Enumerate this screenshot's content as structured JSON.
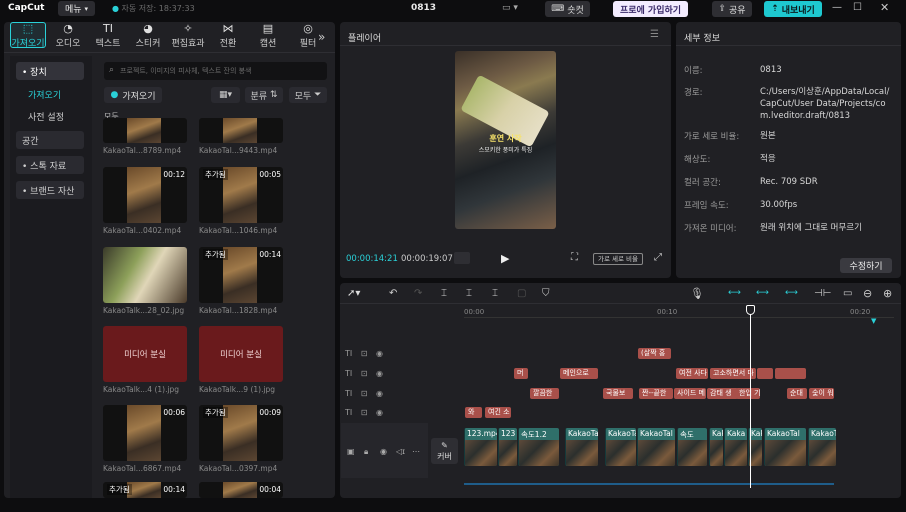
{
  "app": {
    "logo": "CapCut",
    "menu": "메뉴",
    "autosave": "자동 저장: 18:37:33",
    "project": "0813",
    "shortcut": "숏컷",
    "pro": "프로에 가입하기",
    "share": "공유",
    "export": "내보내기"
  },
  "tools": [
    {
      "label": "가져오기",
      "icon": "import-icon",
      "glyph": "⬚"
    },
    {
      "label": "오디오",
      "icon": "audio-icon",
      "glyph": "◔"
    },
    {
      "label": "텍스트",
      "icon": "text-icon",
      "glyph": "TI"
    },
    {
      "label": "스티커",
      "icon": "sticker-icon",
      "glyph": "◕"
    },
    {
      "label": "편집효과",
      "icon": "effects-icon",
      "glyph": "✧"
    },
    {
      "label": "전환",
      "icon": "transition-icon",
      "glyph": "⋈"
    },
    {
      "label": "캡션",
      "icon": "caption-icon",
      "glyph": "▤"
    },
    {
      "label": "필터",
      "icon": "filter-icon",
      "glyph": "◎"
    }
  ],
  "sidebar": {
    "device": "• 장치",
    "import": "가져오기",
    "presets": "사전 설정",
    "space": "공간",
    "stock": "• 스톡 자료",
    "brand": "• 브랜드 자산"
  },
  "media": {
    "search_placeholder": "프로젝트, 이미지의 피사체, 텍스트 잔의 봉색",
    "import_btn": "가져오기",
    "sort": "분류",
    "all_filter": "모두",
    "section": "모두",
    "items": [
      {
        "name": "KakaoTal...8789.mp4",
        "dur": "",
        "chip": ""
      },
      {
        "name": "KakaoTal...9443.mp4",
        "dur": "",
        "chip": ""
      },
      {
        "name": "KakaoTal...0402.mp4",
        "dur": "00:12",
        "chip": ""
      },
      {
        "name": "KakaoTal...1046.mp4",
        "dur": "00:05",
        "chip": "추가됨"
      },
      {
        "name": "KakaoTalk...28_02.jpg",
        "dur": "",
        "chip": ""
      },
      {
        "name": "KakaoTal...1828.mp4",
        "dur": "00:14",
        "chip": "추가됨"
      },
      {
        "name": "KakaoTalk...4 (1).jpg",
        "dur": "",
        "chip": "",
        "missing": "미디어 분실"
      },
      {
        "name": "KakaoTalk...9 (1).jpg",
        "dur": "",
        "chip": "",
        "missing": "미디어 분실"
      },
      {
        "name": "KakaoTal...6867.mp4",
        "dur": "00:06",
        "chip": ""
      },
      {
        "name": "KakaoTal...0397.mp4",
        "dur": "00:09",
        "chip": "추가됨"
      },
      {
        "name": "",
        "dur": "00:14",
        "chip": "추가됨"
      },
      {
        "name": "",
        "dur": "00:04",
        "chip": ""
      }
    ]
  },
  "player": {
    "title": "플레이어",
    "current": "00:00:14:21",
    "total": "00:00:19:07",
    "ratio": "가로 세로 비율",
    "caption_main": "훈연 사작",
    "caption_sub": "스모키한 풍미가 특징"
  },
  "details": {
    "title": "세부 정보",
    "rows": [
      {
        "label": "이름:",
        "value": "0813"
      },
      {
        "label": "경로:",
        "value": "C:/Users/이상훈/AppData/Local/CapCut/User Data/Projects/com.lveditor.draft/0813"
      },
      {
        "label": "가로 세로 비율:",
        "value": "원본"
      },
      {
        "label": "해상도:",
        "value": "적응"
      },
      {
        "label": "컬러 공간:",
        "value": "Rec. 709 SDR"
      },
      {
        "label": "프레임 속도:",
        "value": "30.00fps"
      },
      {
        "label": "가져온 미디어:",
        "value": "원래 위치에 그대로 머무르기"
      }
    ],
    "edit_btn": "수정하기"
  },
  "timeline": {
    "ruler": [
      "00:00",
      "00:10",
      "00:20"
    ],
    "cover": "커버",
    "text_clips": [
      [
        "(살짝 홍"
      ],
      [
        "머",
        "메인으로",
        "여전 사다",
        "고소하면서 다",
        "",
        ""
      ],
      [
        "깔끔한",
        "국물보",
        "짠--끝한",
        "사이드 메",
        "감태 생",
        "한입 기",
        "순대",
        "숯이 워"
      ],
      [
        "와",
        "여긴 소"
      ]
    ],
    "video_clips": [
      "123.mp4",
      "123",
      "속도1.2",
      "KakaoTa",
      "KakaoTa",
      "KakaoTal",
      "속도",
      "KakaoTa",
      "Kaka",
      "KakaoTa",
      "KakaoTal",
      "KakaoTa"
    ]
  },
  "colors": {
    "accent": "#2ad1d8",
    "export": "#1ec8d0",
    "pro": "#f0e6ff",
    "clip": "#a9504a",
    "video": "#2f6f6a"
  }
}
